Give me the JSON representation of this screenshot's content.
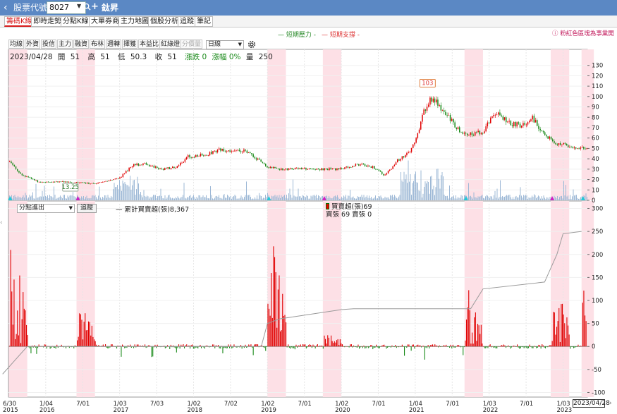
{
  "header": {
    "back": "‹",
    "code_label": "股票代號",
    "code_value": "8027",
    "add": "+",
    "stock_name": "鈦昇"
  },
  "tabs": [
    "籌碼K線",
    "即時走勢",
    "分點K線",
    "大單券商",
    "主力地圖",
    "個股分析",
    "追蹤",
    "筆記"
  ],
  "legend": {
    "support": "— 短期壓力 -",
    "resistance": "— 短期支撐 -",
    "note": "ⓘ 粉紅色區塊為事業開"
  },
  "toolbar": {
    "buttons": [
      "均線",
      "外資",
      "投信",
      "主力",
      "融資",
      "布林",
      "週轉",
      "擇獲",
      "本益比",
      "紅綠燈",
      "分價量"
    ],
    "period": "日線"
  },
  "ohlc": {
    "date": "2023/04/28",
    "open_label": "開",
    "open": "51",
    "high_label": "高",
    "high": "51",
    "low_label": "低",
    "low": "50.3",
    "close_label": "收",
    "close": "51",
    "change": "漲跌 0",
    "pct": "漲幅 0%",
    "vol_label": "量",
    "vol": "250"
  },
  "indicator": {
    "select": "分點進出",
    "track_button": "追蹤",
    "cum_legend": "— 累計買賣超(張)8,367",
    "net_legend": "買賣超(張)69",
    "net_detail": "買張 69 賣張 0"
  },
  "date_end": "2023/04/28",
  "chart_data": [
    {
      "type": "line",
      "name": "price-panel",
      "y_ticks": [
        0,
        10,
        20,
        30,
        40,
        50,
        60,
        70,
        80,
        90,
        100,
        110,
        120,
        130
      ],
      "ylim": [
        0,
        140
      ],
      "annotations": [
        {
          "label": "103",
          "date": "2021/03"
        },
        {
          "label": "13.25",
          "date": "2016/05"
        }
      ],
      "price_points": [
        [
          "2015/06",
          40
        ],
        [
          "2015/07",
          37
        ],
        [
          "2015/09",
          25
        ],
        [
          "2015/12",
          17
        ],
        [
          "2016/03",
          18
        ],
        [
          "2016/06",
          17
        ],
        [
          "2016/09",
          16
        ],
        [
          "2016/12",
          20
        ],
        [
          "2017/01",
          22
        ],
        [
          "2017/03",
          34
        ],
        [
          "2017/05",
          35
        ],
        [
          "2017/08",
          30
        ],
        [
          "2017/10",
          32
        ],
        [
          "2017/12",
          42
        ],
        [
          "2018/03",
          44
        ],
        [
          "2018/05",
          49
        ],
        [
          "2018/07",
          47
        ],
        [
          "2018/09",
          48
        ],
        [
          "2018/11",
          41
        ],
        [
          "2019/01",
          32
        ],
        [
          "2019/03",
          30
        ],
        [
          "2019/06",
          31
        ],
        [
          "2019/09",
          30
        ],
        [
          "2019/12",
          30
        ],
        [
          "2020/02",
          32
        ],
        [
          "2020/04",
          35
        ],
        [
          "2020/06",
          32
        ],
        [
          "2020/08",
          24
        ],
        [
          "2020/10",
          38
        ],
        [
          "2020/12",
          47
        ],
        [
          "2021/01",
          57
        ],
        [
          "2021/02",
          80
        ],
        [
          "2021/03",
          95
        ],
        [
          "2021/04",
          98
        ],
        [
          "2021/05",
          88
        ],
        [
          "2021/06",
          82
        ],
        [
          "2021/08",
          68
        ],
        [
          "2021/10",
          63
        ],
        [
          "2021/12",
          67
        ],
        [
          "2022/02",
          84
        ],
        [
          "2022/04",
          75
        ],
        [
          "2022/06",
          72
        ],
        [
          "2022/08",
          79
        ],
        [
          "2022/10",
          62
        ],
        [
          "2022/12",
          55
        ],
        [
          "2023/02",
          52
        ],
        [
          "2023/04",
          51
        ]
      ]
    },
    {
      "type": "bar",
      "name": "net-buy-panel",
      "y_ticks": [
        -100,
        -50,
        0,
        50,
        100,
        150,
        200,
        250,
        300
      ],
      "ylim": [
        -110,
        310
      ],
      "cumulative_points": [
        [
          "2015/06",
          -60
        ],
        [
          "2015/08",
          -30
        ],
        [
          "2015/10",
          0
        ],
        [
          "2016/07",
          0
        ],
        [
          "2016/09",
          0
        ],
        [
          "2018/12",
          0
        ],
        [
          "2019/01",
          50
        ],
        [
          "2019/03",
          60
        ],
        [
          "2020/01",
          80
        ],
        [
          "2020/03",
          82
        ],
        [
          "2021/10",
          82
        ],
        [
          "2021/12",
          125
        ],
        [
          "2022/10",
          140
        ],
        [
          "2022/12",
          200
        ],
        [
          "2023/01",
          245
        ],
        [
          "2023/04",
          250
        ]
      ],
      "bursts": [
        {
          "start": "2015/07",
          "end": "2015/09",
          "peak": 265
        },
        {
          "start": "2016/06",
          "end": "2016/08",
          "peak": 92
        },
        {
          "start": "2019/01",
          "end": "2019/03",
          "peak": 240
        },
        {
          "start": "2019/10",
          "end": "2019/12",
          "peak": 35
        },
        {
          "start": "2021/09",
          "end": "2021/11",
          "peak": 110
        },
        {
          "start": "2022/11",
          "end": "2023/01",
          "peak": 145
        },
        {
          "start": "2023/04",
          "end": "2023/04",
          "peak": 185
        }
      ],
      "highlight_periods": [
        [
          "2015/07",
          "2015/09"
        ],
        [
          "2016/06",
          "2016/08"
        ],
        [
          "2019/01",
          "2019/03"
        ],
        [
          "2019/10",
          "2019/12"
        ],
        [
          "2021/09",
          "2021/11"
        ],
        [
          "2022/11",
          "2023/01"
        ],
        [
          "2023/04",
          "2023/05"
        ]
      ],
      "x_ticks": [
        [
          "6/30",
          "2015"
        ],
        [
          "1/04",
          "2016"
        ],
        [
          "7/01",
          ""
        ],
        [
          "1/03",
          "2017"
        ],
        [
          "7/03",
          ""
        ],
        [
          "1/02",
          "2018"
        ],
        [
          "7/02",
          ""
        ],
        [
          "1/02",
          "2019"
        ],
        [
          "7/01",
          ""
        ],
        [
          "1/02",
          "2020"
        ],
        [
          "7/01",
          ""
        ],
        [
          "1/04",
          "2021"
        ],
        [
          "7/01",
          ""
        ],
        [
          "1/03",
          "2022"
        ],
        [
          "7/01",
          ""
        ],
        [
          "1/03",
          "2023"
        ]
      ]
    }
  ],
  "colors": {
    "topbar": "#5b88c4",
    "up": "#e00000",
    "down": "#1a8a1a",
    "highlight": "#fde0e6",
    "volume": "#9db8d6"
  }
}
